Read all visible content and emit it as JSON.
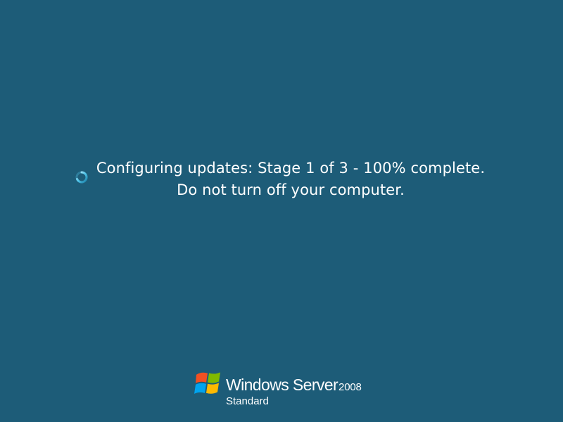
{
  "status": {
    "line1": "Configuring updates: Stage 1 of 3 - 100% complete.",
    "line2": "Do not turn off your computer."
  },
  "spinner": {
    "icon": "busy-spinner-icon",
    "color": "#5fc6e6"
  },
  "branding": {
    "logo_icon": "windows-flag-icon",
    "product_name": "Windows Server",
    "product_version": "2008",
    "edition": "Standard"
  },
  "colors": {
    "background": "#1d5c78",
    "text": "#ffffff"
  }
}
